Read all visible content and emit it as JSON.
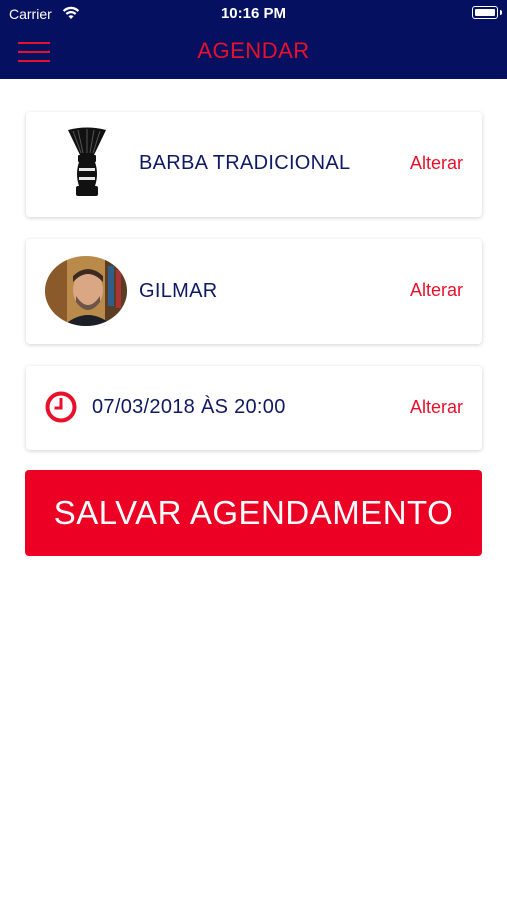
{
  "status_bar": {
    "carrier": "Carrier",
    "time": "10:16 PM"
  },
  "nav": {
    "title": "AGENDAR"
  },
  "service": {
    "name": "BARBA TRADICIONAL",
    "action": "Alterar"
  },
  "barber": {
    "name": "GILMAR",
    "action": "Alterar"
  },
  "schedule": {
    "datetime": "07/03/2018 ÀS 20:00",
    "action": "Alterar"
  },
  "save_button": {
    "label": "SALVAR AGENDAMENTO"
  },
  "colors": {
    "header": "#051160",
    "accent": "#e8102a",
    "button": "#ec0023",
    "text": "#0f1a63"
  }
}
